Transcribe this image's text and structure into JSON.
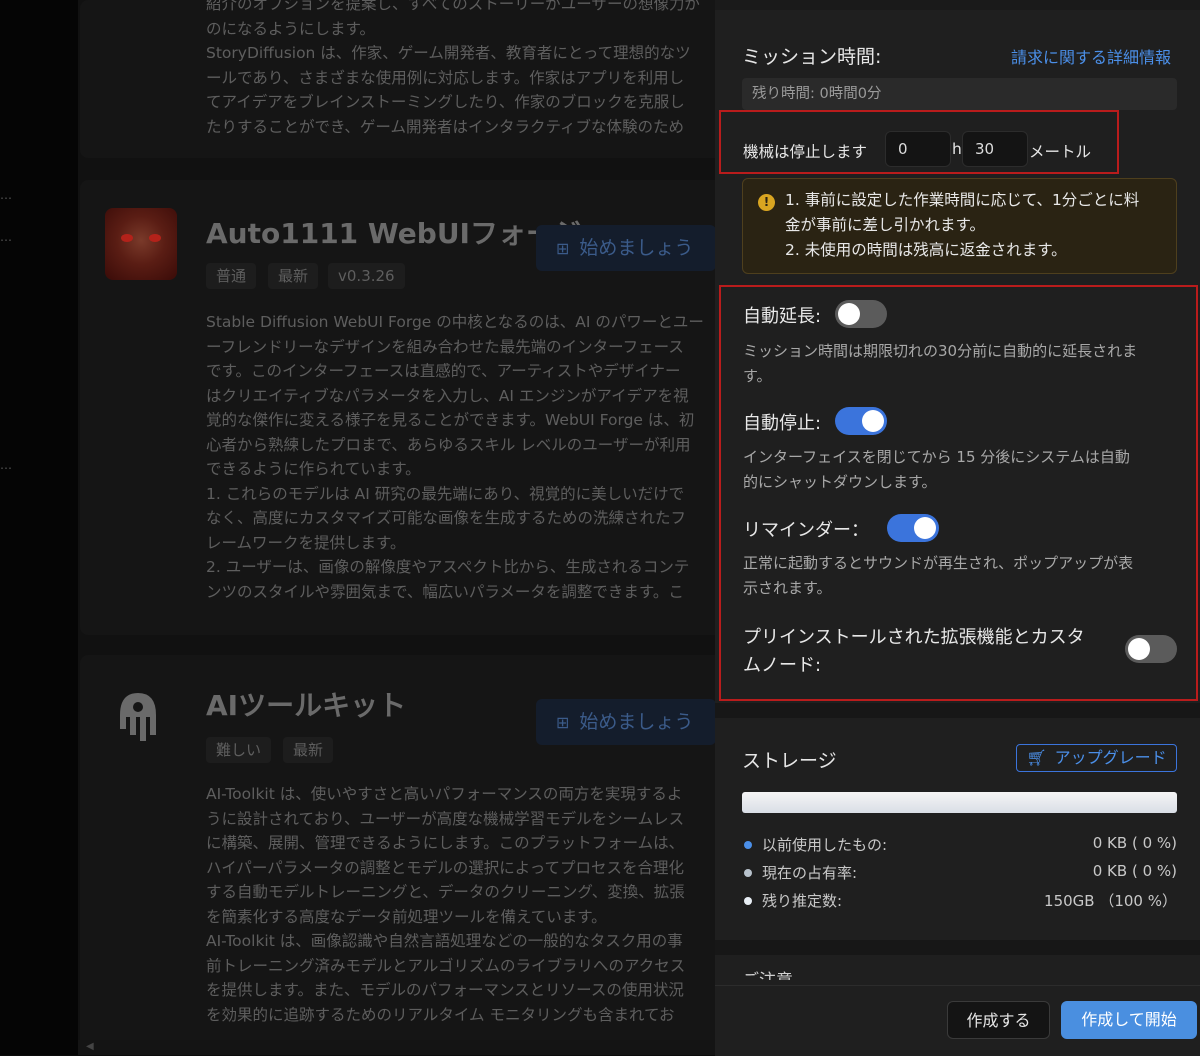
{
  "background": {
    "card1": {
      "text": "紹介のオプションを提案し、すべてのストーリーがユーザーの想像力が\nのになるようにします。\nStoryDiffusion は、作家、ゲーム開発者、教育者にとって理想的なツ\nールであり、さまざまな使用例に対応します。作家はアプリを利用し\nてアイデアをブレインストーミングしたり、作家のブロックを克服し\nたりすることができ、ゲーム開発者はインタラクティブな体験のため"
    },
    "card2": {
      "title": "Auto1111 WebUIフォージ",
      "tags": [
        "普通",
        "最新",
        "v0.3.26"
      ],
      "start_label": "始めましょう",
      "text": "Stable Diffusion WebUI Forge の中核となるのは、AI のパワーとユー\nーフレンドリーなデザインを組み合わせた最先端のインターフェース\nです。このインターフェースは直感的で、アーティストやデザイナー\nはクリエイティブなパラメータを入力し、AI エンジンがアイデアを視\n覚的な傑作に変える様子を見ることができます。WebUI Forge は、初\n心者から熟練したプロまで、あらゆるスキル レベルのユーザーが利用\nできるように作られています。\n1. これらのモデルは AI 研究の最先端にあり、視覚的に美しいだけで\nなく、高度にカスタマイズ可能な画像を生成するための洗練されたフ\nレームワークを提供します。\n2. ユーザーは、画像の解像度やアスペクト比から、生成されるコンテ\nンツのスタイルや雰囲気まで、幅広いパラメータを調整できます。こ"
    },
    "card3": {
      "title": "AIツールキット",
      "tags": [
        "難しい",
        "最新"
      ],
      "start_label": "始めましょう",
      "text": "AI-Toolkit は、使いやすさと高いパフォーマンスの両方を実現するよ\nうに設計されており、ユーザーが高度な機械学習モデルをシームレス\nに構築、展開、管理できるようにします。このプラットフォームは、\nハイパーパラメータの調整とモデルの選択によってプロセスを合理化\nする自動モデルトレーニングと、データのクリーニング、変換、拡張\nを簡素化する高度なデータ前処理ツールを備えています。\nAI-Toolkit は、画像認識や自然言語処理などの一般的なタスク用の事\n前トレーニング済みモデルとアルゴリズムのライブラリへのアクセス\nを提供します。また、モデルのパフォーマンスとリソースの使用状況\nを効果的に追跡するためのリアルタイム モニタリングも含まれてお"
    }
  },
  "panel": {
    "mission": {
      "title": "ミッション時間:",
      "billing_link": "請求に関する詳細情報",
      "remaining": "残り時間: 0時間0分",
      "stop_label": "機械は停止します",
      "hours_value": "0",
      "hours_unit": "h",
      "minutes_value": "30",
      "minutes_unit": "メートル",
      "warning": "1. 事前に設定した作業時間に応じて、1分ごとに料\n金が事前に差し引かれます。\n2. 未使用の時間は残高に返金されます。"
    },
    "options": {
      "auto_extend": {
        "label": "自動延長:",
        "on": false,
        "desc": "ミッション時間は期限切れの30分前に自動的に延長されま\nす。"
      },
      "auto_stop": {
        "label": "自動停止:",
        "on": true,
        "desc": "インターフェイスを閉じてから 15 分後にシステムは自動\n的にシャットダウンします。"
      },
      "reminder": {
        "label": "リマインダー：",
        "on": true,
        "desc": "正常に起動するとサウンドが再生され、ポップアップが表\n示されます。"
      },
      "preinstalled": {
        "label_line1": "プリインストールされた拡張機能とカスタ",
        "label_line2": "ムノード:",
        "on": false
      }
    },
    "storage": {
      "title": "ストレージ",
      "upgrade_label": "アップグレード",
      "legend": [
        {
          "name": "以前使用したもの:",
          "value": "0 KB ( 0 %)",
          "color": "#4b8fe8"
        },
        {
          "name": "現在の占有率:",
          "value": "0 KB ( 0 %)",
          "color": "#b8c2cc"
        },
        {
          "name": "残り推定数:",
          "value": "150GB （100 %）",
          "color": "#e8eef4"
        }
      ]
    },
    "notice_partial": "ご注意",
    "footer": {
      "create_label": "作成する",
      "create_start_label": "作成して開始"
    }
  }
}
